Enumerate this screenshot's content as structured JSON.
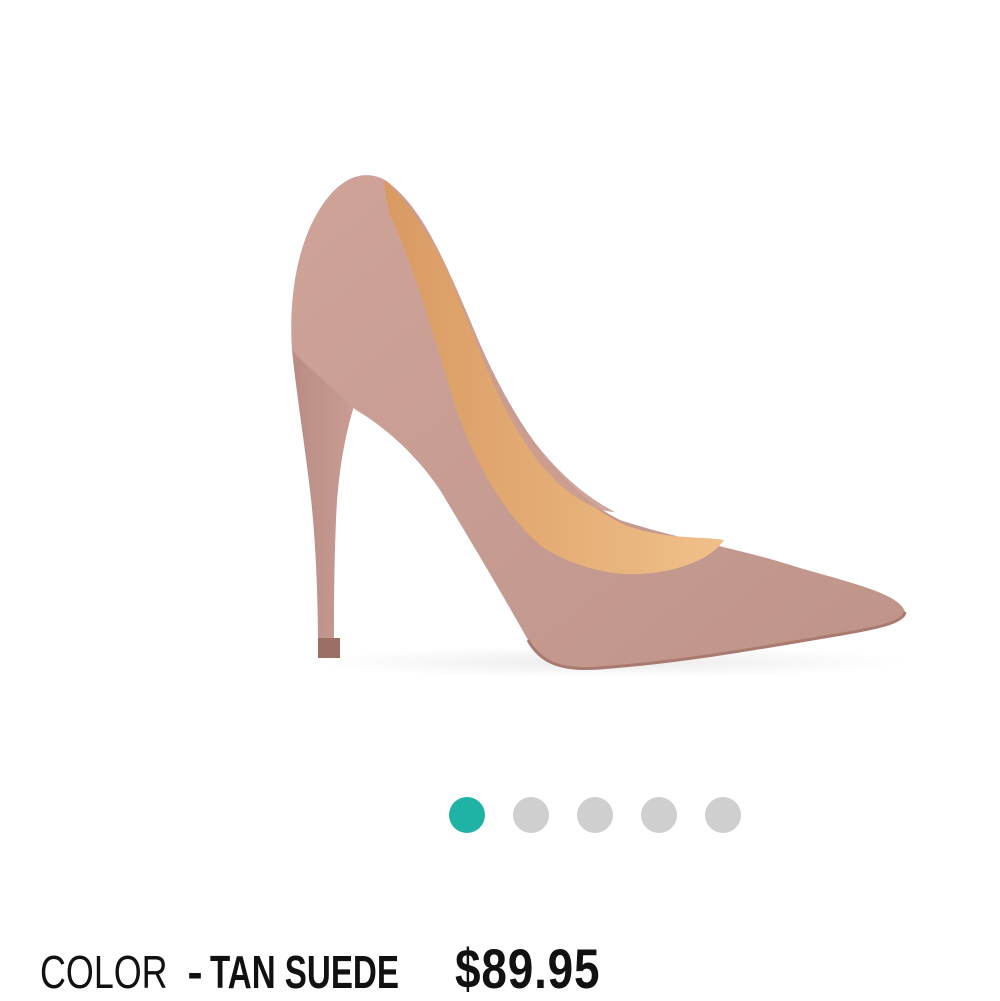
{
  "product": {
    "image_alt": "pump-shoe-image",
    "color_label": "COLOR",
    "color_separator": "-",
    "color_value": "TAN SUEDE",
    "price": "$89.95"
  },
  "carousel": {
    "total": 5,
    "active_index": 0
  },
  "colors": {
    "suede": "#c99c92",
    "lining": "#e8b07a",
    "dot_active": "#1fb3a6",
    "dot_inactive": "#cfcfcf",
    "text": "#111111"
  }
}
